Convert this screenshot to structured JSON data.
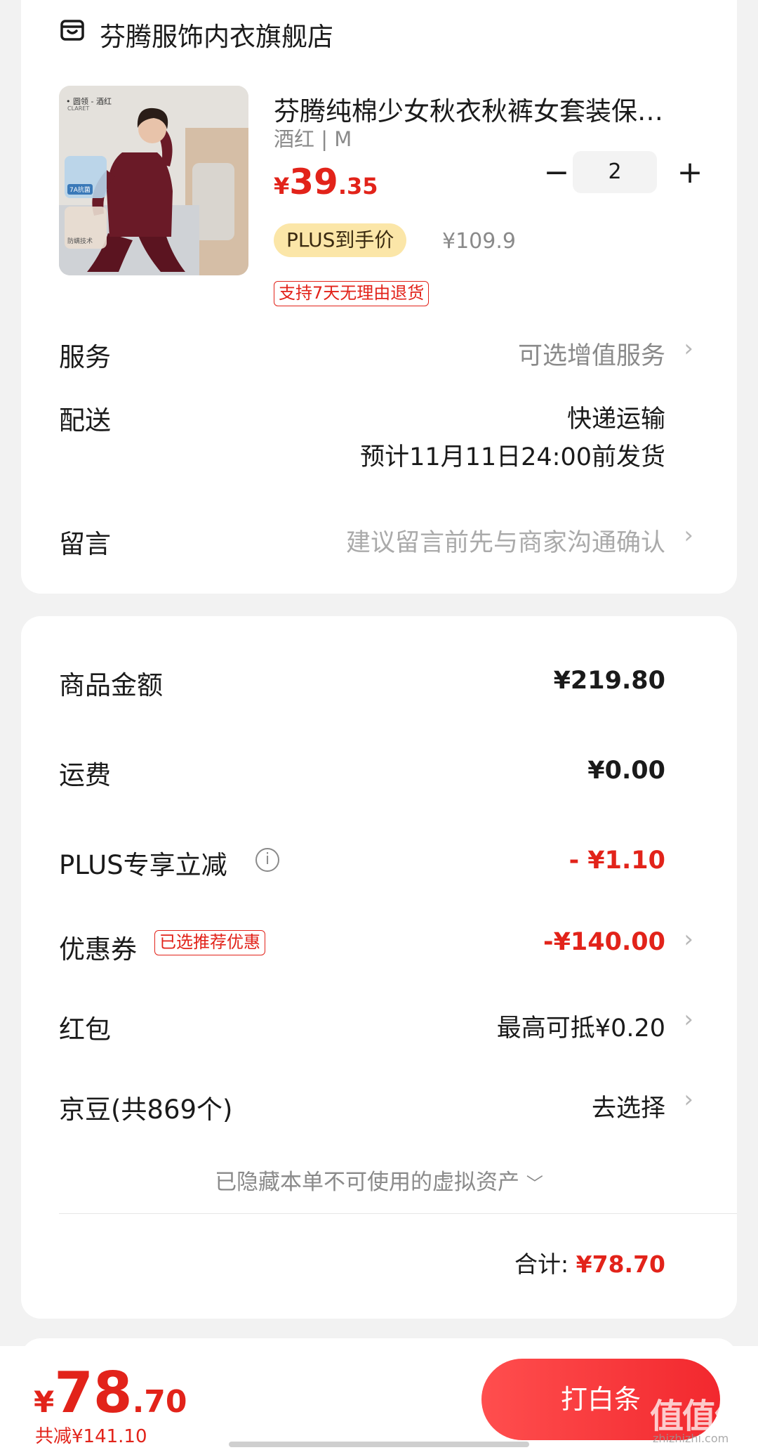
{
  "shop": {
    "icon": "store-icon",
    "name": "芬腾服饰内衣旗舰店"
  },
  "product": {
    "title": "芬腾纯棉少女秋衣秋裤女套装保暖内衣女士圆领修身打底",
    "spec": "酒红 | M",
    "price_currency": "¥",
    "price_int": "39",
    "price_dec": ".35",
    "plus_tag": "PLUS到手价",
    "original_price": "¥109.9",
    "return_tag": "支持7天无理由退货",
    "image_caption_top": "• 圆领 - 酒红",
    "image_caption_sub": "CLARET",
    "image_badge_1": "7A抗菌",
    "image_badge_2": "防螨技术",
    "quantity": "2",
    "qty_minus": "−",
    "qty_plus": "+"
  },
  "service": {
    "label": "服务",
    "value": "可选增值服务"
  },
  "delivery": {
    "label": "配送",
    "method": "快递运输",
    "eta": "预计11月11日24:00前发货"
  },
  "message": {
    "label": "留言",
    "placeholder": "建议留言前先与商家沟通确认"
  },
  "summary": {
    "goods_label": "商品金额",
    "goods_value": "¥219.80",
    "shipping_label": "运费",
    "shipping_value": "¥0.00",
    "plus_label": "PLUS专享立减",
    "plus_value": "- ¥1.10",
    "coupon_label": "优惠券",
    "coupon_tag": "已选推荐优惠",
    "coupon_value": "-¥140.00",
    "redpack_label": "红包",
    "redpack_value": "最高可抵¥0.20",
    "jingdou_label": "京豆(共869个)",
    "jingdou_value": "去选择",
    "hidden_assets": "已隐藏本单不可使用的虚拟资产",
    "total_label": "合计:",
    "total_value": "¥78.70"
  },
  "footer": {
    "price_currency": "¥",
    "price_int": "78",
    "price_dec": ".70",
    "saved": "共减¥141.10",
    "pay_button": "打白条",
    "watermark": "值值值",
    "watermark_url": "zhizhizhi.com"
  },
  "colors": {
    "accent_red": "#e2231a",
    "plus_gold": "#fbe6a8",
    "background": "#f2f2f2"
  }
}
